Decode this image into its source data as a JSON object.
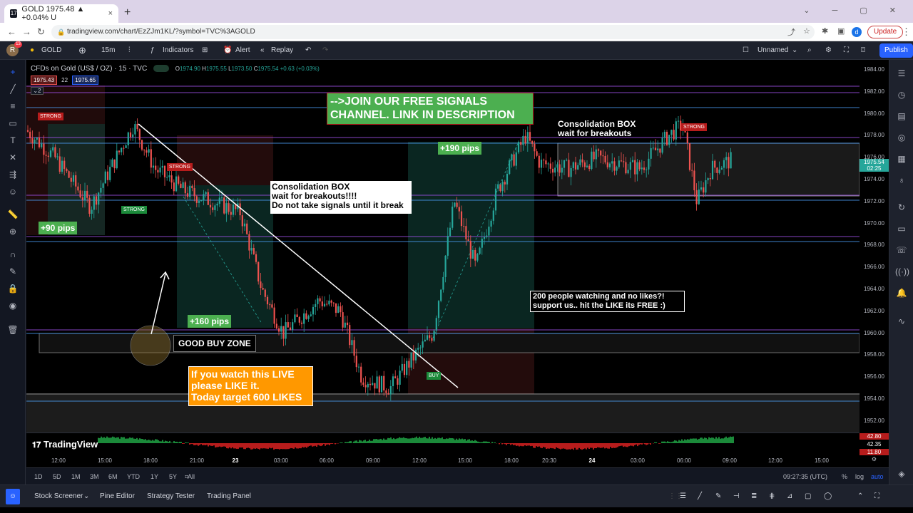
{
  "browser": {
    "tab_title": "GOLD 1975.48 ▲ +0.04% U",
    "tab_close": "×",
    "new_tab": "+",
    "url": "tradingview.com/chart/EzZJm1KL/?symbol=TVC%3AGOLD",
    "update_label": "Update",
    "profile_letter": "d"
  },
  "tv_header": {
    "user_initial": "R",
    "user_badge": "13",
    "symbol": "GOLD",
    "interval": "15m",
    "indicators_label": "Indicators",
    "alert_label": "Alert",
    "replay_label": "Replay",
    "layout_name": "Unnamed",
    "publish_label": "Publish"
  },
  "legend": {
    "title": "CFDs on Gold (US$ / OZ) · 15 · TVC",
    "open": "1974.90",
    "high": "1975.55",
    "low": "1973.50",
    "close": "1975.54",
    "change": "+0.63 (+0.03%)",
    "bid": "1975.43",
    "spread": "22",
    "ask": "1975.65",
    "collapse": "2",
    "o_label": "O",
    "h_label": "H",
    "l_label": "L",
    "c_label": "C"
  },
  "price_axis": {
    "ticks": [
      "1984.00",
      "1982.00",
      "1980.00",
      "1978.00",
      "1976.00",
      "1974.00",
      "1972.00",
      "1970.00",
      "1968.00",
      "1966.00",
      "1964.00",
      "1962.00",
      "1960.00",
      "1958.00",
      "1956.00",
      "1954.00",
      "1952.00"
    ],
    "current_price": "1975.54",
    "countdown": "02:25",
    "osc_top": "42.80",
    "osc_mid": "42.35",
    "osc_low": "11.80"
  },
  "time_axis": {
    "ticks": [
      "12:00",
      "15:00",
      "18:00",
      "21:00",
      "23",
      "03:00",
      "06:00",
      "09:00",
      "12:00",
      "15:00",
      "18:00",
      "20:30",
      "24",
      "03:00",
      "06:00",
      "09:00",
      "12:00",
      "15:00"
    ]
  },
  "annotations": {
    "join_line1": "-->JOIN OUR FREE SIGNALS",
    "join_line2": "CHANNEL. LINK IN DESCRIPTION",
    "consol1_line1": "Consolidation BOX",
    "consol1_line2": "wait for breakouts!!!!",
    "consol1_line3": "Do not take signals until it break",
    "consol2_line1": "Consolidation BOX",
    "consol2_line2": "wait for breakouts",
    "pips_190": "+190 pips",
    "pips_90": "+90 pips",
    "pips_160": "+160 pips",
    "good_buy": "GOOD BUY ZONE",
    "like_line1": "If you watch this LIVE",
    "like_line2": "please LIKE it.",
    "like_line3": "Today target 600 LIKES",
    "people_line1": "200 people watching and no likes?!",
    "people_line2": "support us.. hit the LIKE its FREE :)",
    "strong1": "STRONG",
    "strong2": "STRONG",
    "strong3": "STRONG",
    "strong4": "STRONG",
    "buy": "BUY",
    "watermark": "TradingView"
  },
  "range_bar": {
    "ranges": [
      "1D",
      "5D",
      "1M",
      "3M",
      "6M",
      "YTD",
      "1Y",
      "5Y",
      "All"
    ],
    "clock": "09:27:35 (UTC)",
    "percent": "%",
    "log": "log",
    "auto": "auto"
  },
  "bottom_bar": {
    "stock_screener": "Stock Screener",
    "pine_editor": "Pine Editor",
    "strategy_tester": "Strategy Tester",
    "trading_panel": "Trading Panel"
  },
  "colors": {
    "up": "#26a69a",
    "down": "#ef5350",
    "accent": "#2962ff",
    "annotation_green": "#4caf50",
    "annotation_orange": "#ff9800"
  }
}
